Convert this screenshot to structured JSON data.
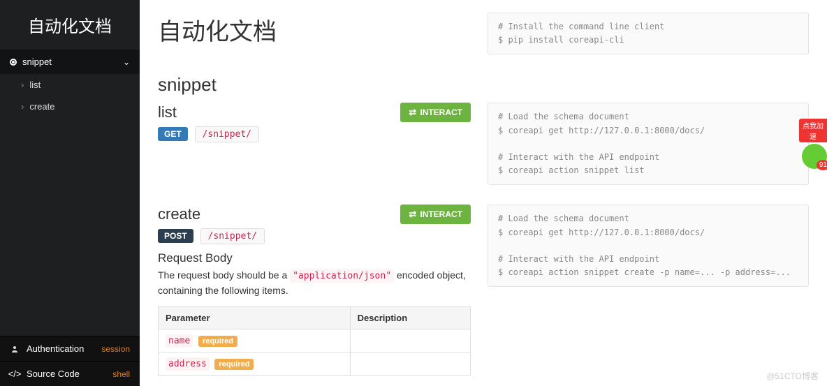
{
  "sidebar": {
    "title": "自动化文档",
    "section_label": "snippet",
    "items": [
      "list",
      "create"
    ],
    "footer": {
      "auth_label": "Authentication",
      "auth_value": "session",
      "source_label": "Source Code",
      "source_value": "shell"
    }
  },
  "header": {
    "page_title": "自动化文档"
  },
  "install_shell": "# Install the command line client\n$ pip install coreapi-cli",
  "section_title": "snippet",
  "interact_label": "INTERACT",
  "endpoints": {
    "list": {
      "title": "list",
      "method": "GET",
      "path": "/snippet/",
      "shell": "# Load the schema document\n$ coreapi get http://127.0.0.1:8000/docs/\n\n# Interact with the API endpoint\n$ coreapi action snippet list"
    },
    "create": {
      "title": "create",
      "method": "POST",
      "path": "/snippet/",
      "request_body_heading": "Request Body",
      "request_body_desc_pre": "The request body should be a ",
      "request_body_encoding": "\"application/json\"",
      "request_body_desc_post": " encoded object, containing the following items.",
      "table": {
        "col_param": "Parameter",
        "col_desc": "Description",
        "rows": [
          {
            "name": "name",
            "required": "required",
            "desc": ""
          },
          {
            "name": "address",
            "required": "required",
            "desc": ""
          }
        ]
      },
      "shell": "# Load the schema document\n$ coreapi get http://127.0.0.1:8000/docs/\n\n# Interact with the API endpoint\n$ coreapi action snippet create -p name=... -p address=..."
    }
  },
  "float_widget": {
    "tag": "点我加速"
  },
  "watermark": "@51CTO博客"
}
